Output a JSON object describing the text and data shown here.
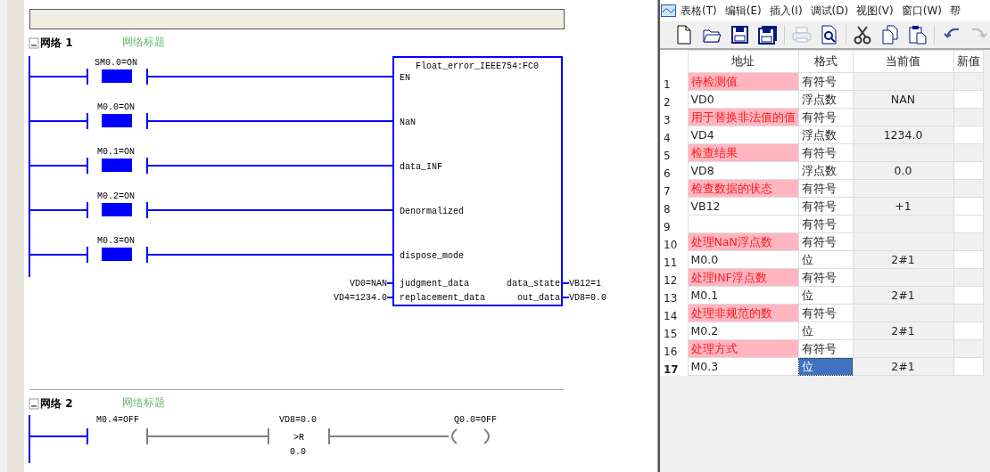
{
  "editor": {
    "networks": [
      {
        "label": "网络 1",
        "title": "网络标题",
        "contacts": [
          {
            "address": "SM0.0=ON",
            "on": true
          },
          {
            "address": "M0.0=ON",
            "on": true
          },
          {
            "address": "M0.1=ON",
            "on": true
          },
          {
            "address": "M0.2=ON",
            "on": true
          },
          {
            "address": "M0.3=ON",
            "on": true
          }
        ],
        "block": {
          "name": "Float_error_IEEE754:FC0",
          "bool_inputs": [
            "EN",
            "NaN",
            "data_INF",
            "Denormalized",
            "dispose_mode"
          ],
          "value_inputs": [
            {
              "label": "judgment_data",
              "value": "VD0=NAN"
            },
            {
              "label": "replacement_data",
              "value": "VD4=1234.0"
            }
          ],
          "outputs": [
            {
              "label": "data_state",
              "value": "VB12=1"
            },
            {
              "label": "out_data",
              "value": "VD8=0.0"
            }
          ]
        }
      },
      {
        "label": "网络 2",
        "title": "网络标题",
        "elements": [
          {
            "kind": "contact",
            "address": "M0.4=OFF",
            "on": false
          },
          {
            "kind": "compare",
            "operand_1": "VD8=0.0",
            "operator": ">R",
            "operand_2": "0.0",
            "on": false
          },
          {
            "kind": "coil",
            "address": "Q0.0=OFF",
            "on": false
          }
        ]
      }
    ]
  },
  "status_chart": {
    "menu": [
      "表格(T)",
      "编辑(E)",
      "插入(I)",
      "调试(D)",
      "视图(V)",
      "窗口(W)",
      "帮"
    ],
    "toolbar": [
      {
        "kind": "new",
        "disabled": false
      },
      {
        "kind": "open",
        "disabled": false
      },
      {
        "kind": "save",
        "disabled": false
      },
      {
        "kind": "saveall",
        "disabled": false
      },
      {
        "kind": "sep"
      },
      {
        "kind": "print",
        "disabled": true
      },
      {
        "kind": "preview",
        "disabled": false
      },
      {
        "kind": "sep"
      },
      {
        "kind": "cut",
        "disabled": false
      },
      {
        "kind": "copy",
        "disabled": false
      },
      {
        "kind": "paste",
        "disabled": false
      },
      {
        "kind": "sep"
      },
      {
        "kind": "undo",
        "disabled": false
      },
      {
        "kind": "redo",
        "disabled": true
      }
    ],
    "columns": [
      "地址",
      "格式",
      "当前值",
      "新值"
    ],
    "rows": [
      {
        "number": "1",
        "kind": "comment",
        "address": "待检测值",
        "format": "有符号",
        "selected": false
      },
      {
        "number": "2",
        "kind": "data",
        "address": "VD0",
        "format": "浮点数",
        "value": "NAN",
        "selected": false
      },
      {
        "number": "3",
        "kind": "comment",
        "address": "用于替换非法值的值",
        "format": "有符号",
        "selected": false
      },
      {
        "number": "4",
        "kind": "data",
        "address": "VD4",
        "format": "浮点数",
        "value": "1234.0",
        "selected": false
      },
      {
        "number": "5",
        "kind": "comment",
        "address": "检查结果",
        "format": "有符号",
        "selected": false
      },
      {
        "number": "6",
        "kind": "data",
        "address": "VD8",
        "format": "浮点数",
        "value": "0.0",
        "selected": false
      },
      {
        "number": "7",
        "kind": "comment",
        "address": "检查数据的状态",
        "format": "有符号",
        "selected": false
      },
      {
        "number": "8",
        "kind": "data",
        "address": "VB12",
        "format": "有符号",
        "value": "+1",
        "selected": false
      },
      {
        "number": "9",
        "kind": "data",
        "format": "有符号",
        "selected": false
      },
      {
        "number": "10",
        "kind": "comment",
        "address": "处理NaN浮点数",
        "format": "有符号",
        "selected": false
      },
      {
        "number": "11",
        "kind": "data",
        "address": "M0.0",
        "format": "位",
        "value": "2#1",
        "selected": false
      },
      {
        "number": "12",
        "kind": "comment",
        "address": "处理INF浮点数",
        "format": "有符号",
        "selected": false
      },
      {
        "number": "13",
        "kind": "data",
        "address": "M0.1",
        "format": "位",
        "value": "2#1",
        "selected": false
      },
      {
        "number": "14",
        "kind": "comment",
        "address": "处理非规范的数",
        "format": "有符号",
        "selected": false
      },
      {
        "number": "15",
        "kind": "data",
        "address": "M0.2",
        "format": "位",
        "value": "2#1",
        "selected": false
      },
      {
        "number": "16",
        "kind": "comment",
        "address": "处理方式",
        "format": "有符号",
        "selected": false
      },
      {
        "number": "17",
        "kind": "data",
        "address": "M0.3",
        "format": "位",
        "value": "2#1",
        "selected": true
      }
    ]
  }
}
